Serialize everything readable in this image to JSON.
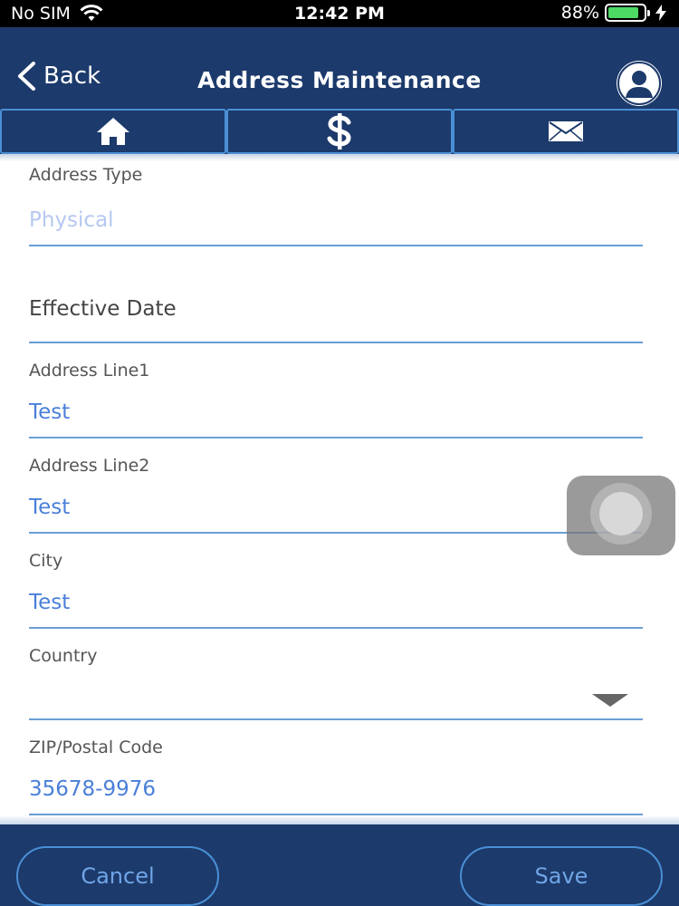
{
  "status_bar": {
    "carrier": "No SIM",
    "time": "12:42 PM",
    "battery_percent": "88%",
    "battery_level": 0.88
  },
  "header": {
    "back_label": "Back",
    "title": "Address Maintenance"
  },
  "tabs": [
    {
      "icon": "home-icon"
    },
    {
      "icon": "dollar-icon"
    },
    {
      "icon": "mail-icon"
    }
  ],
  "form": {
    "address_type": {
      "label": "Address Type",
      "value": "Physical"
    },
    "effective_date": {
      "label": "Effective Date",
      "value": ""
    },
    "address_line1": {
      "label": "Address Line1",
      "value": "Test"
    },
    "address_line2": {
      "label": "Address Line2",
      "value": "Test"
    },
    "city": {
      "label": "City",
      "value": "Test"
    },
    "country": {
      "label": "Country",
      "value": ""
    },
    "zip": {
      "label": "ZIP/Postal Code",
      "value": "35678-9976"
    }
  },
  "footer": {
    "cancel_label": "Cancel",
    "save_label": "Save"
  },
  "colors": {
    "navy": "#1c3a6b",
    "accent": "#4a8fd6",
    "value_text": "#4a7fd9",
    "battery": "#4cd964"
  }
}
